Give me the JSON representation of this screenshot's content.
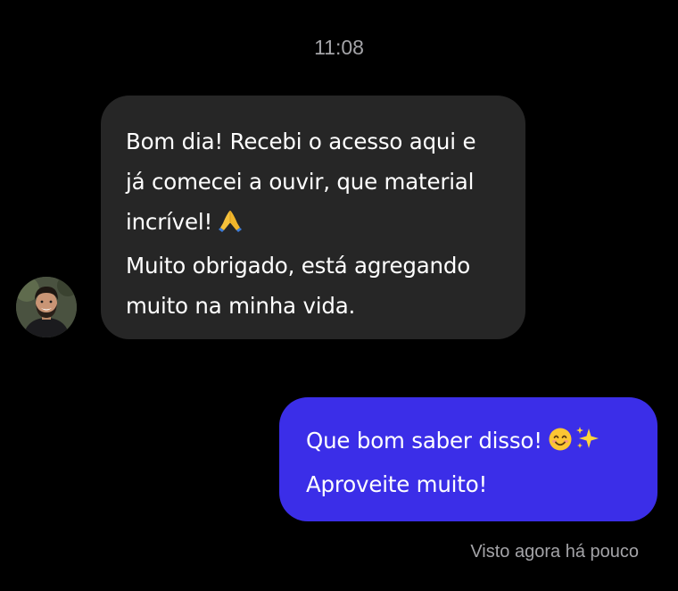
{
  "chat": {
    "timestamp": "11:08",
    "incoming": {
      "avatar_icon": "contact-avatar",
      "lines": [
        "Bom dia! Recebi o acesso aqui e",
        "já comecei a ouvir, que material",
        "incrível!",
        "Muito obrigado, está agregando",
        "muito na minha vida."
      ],
      "emoji_icon": "folded-hands-emoji"
    },
    "outgoing": {
      "lines": [
        "Que bom saber disso!",
        "Aproveite muito!"
      ],
      "emoji_icons": [
        "smiling-face-emoji",
        "sparkles-emoji"
      ]
    },
    "status": "Visto agora há pouco"
  },
  "colors": {
    "background": "#000000",
    "incoming_bubble": "#262626",
    "outgoing_bubble": "#3b2ee8",
    "meta_text": "#a4a4a8",
    "message_text": "#ffffff"
  }
}
